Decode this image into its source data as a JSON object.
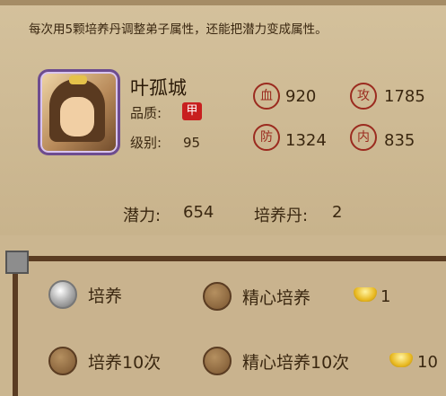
{
  "notice": "每次用5颗培养丹调整弟子属性，还能把潜力变成属性。",
  "character": {
    "name": "叶孤城",
    "quality_label": "品质:",
    "quality_badge": "甲",
    "level_label": "级别:",
    "level": "95"
  },
  "stats": [
    {
      "icon": "血",
      "value": "920"
    },
    {
      "icon": "攻",
      "value": "1785"
    },
    {
      "icon": "防",
      "value": "1324"
    },
    {
      "icon": "内",
      "value": "835"
    }
  ],
  "potential": {
    "label": "潜力:",
    "value": "654"
  },
  "pill": {
    "label": "培养丹:",
    "value": "2"
  },
  "options": [
    {
      "label": "培养",
      "selected": true
    },
    {
      "label": "精心培养",
      "selected": false,
      "cost": "1"
    },
    {
      "label": "培养10次",
      "selected": false
    },
    {
      "label": "精心培养10次",
      "selected": false,
      "cost": "10"
    }
  ]
}
